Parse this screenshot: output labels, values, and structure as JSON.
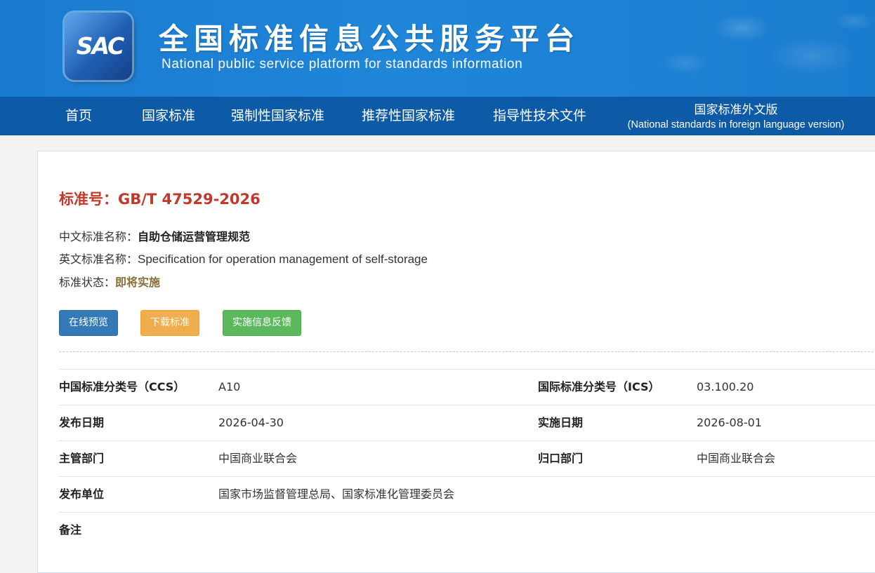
{
  "header": {
    "logo_text": "SAC",
    "title": "全国标准信息公共服务平台",
    "subtitle": "National public service platform  for standards information"
  },
  "nav": {
    "items": [
      {
        "label": "首页"
      },
      {
        "label": "国家标准"
      },
      {
        "label": "强制性国家标准"
      },
      {
        "label": "推荐性国家标准"
      },
      {
        "label": "指导性技术文件"
      }
    ],
    "foreign": {
      "label": "国家标准外文版",
      "sublabel": "(National standards in foreign language version)"
    }
  },
  "standard": {
    "number_label": "标准号：",
    "number": "GB/T 47529-2026",
    "cn_name_label": "中文标准名称：",
    "cn_name": "自助仓储运营管理规范",
    "en_name_label": "英文标准名称：",
    "en_name": "Specification for operation management of self-storage",
    "status_label": "标准状态：",
    "status": "即将实施"
  },
  "actions": {
    "preview": "在线预览",
    "download": "下载标准",
    "feedback": "实施信息反馈"
  },
  "details": {
    "ccs_label": "中国标准分类号（CCS）",
    "ccs": "A10",
    "ics_label": "国际标准分类号（ICS）",
    "ics": "03.100.20",
    "publish_date_label": "发布日期",
    "publish_date": "2026-04-30",
    "implement_date_label": "实施日期",
    "implement_date": "2026-08-01",
    "dept_label": "主管部门",
    "dept": "中国商业联合会",
    "central_dept_label": "归口部门",
    "central_dept": "中国商业联合会",
    "publisher_label": "发布单位",
    "publisher": "国家市场监督管理总局、国家标准化管理委员会",
    "remarks_label": "备注",
    "remarks": ""
  },
  "colors": {
    "banner": "#1f86da",
    "nav": "#0d5aa7",
    "std_number": "#c0392b",
    "status": "#8a6d3b",
    "btn_preview": "#337ab7",
    "btn_download": "#f0ad4e",
    "btn_feedback": "#5cb85c"
  }
}
